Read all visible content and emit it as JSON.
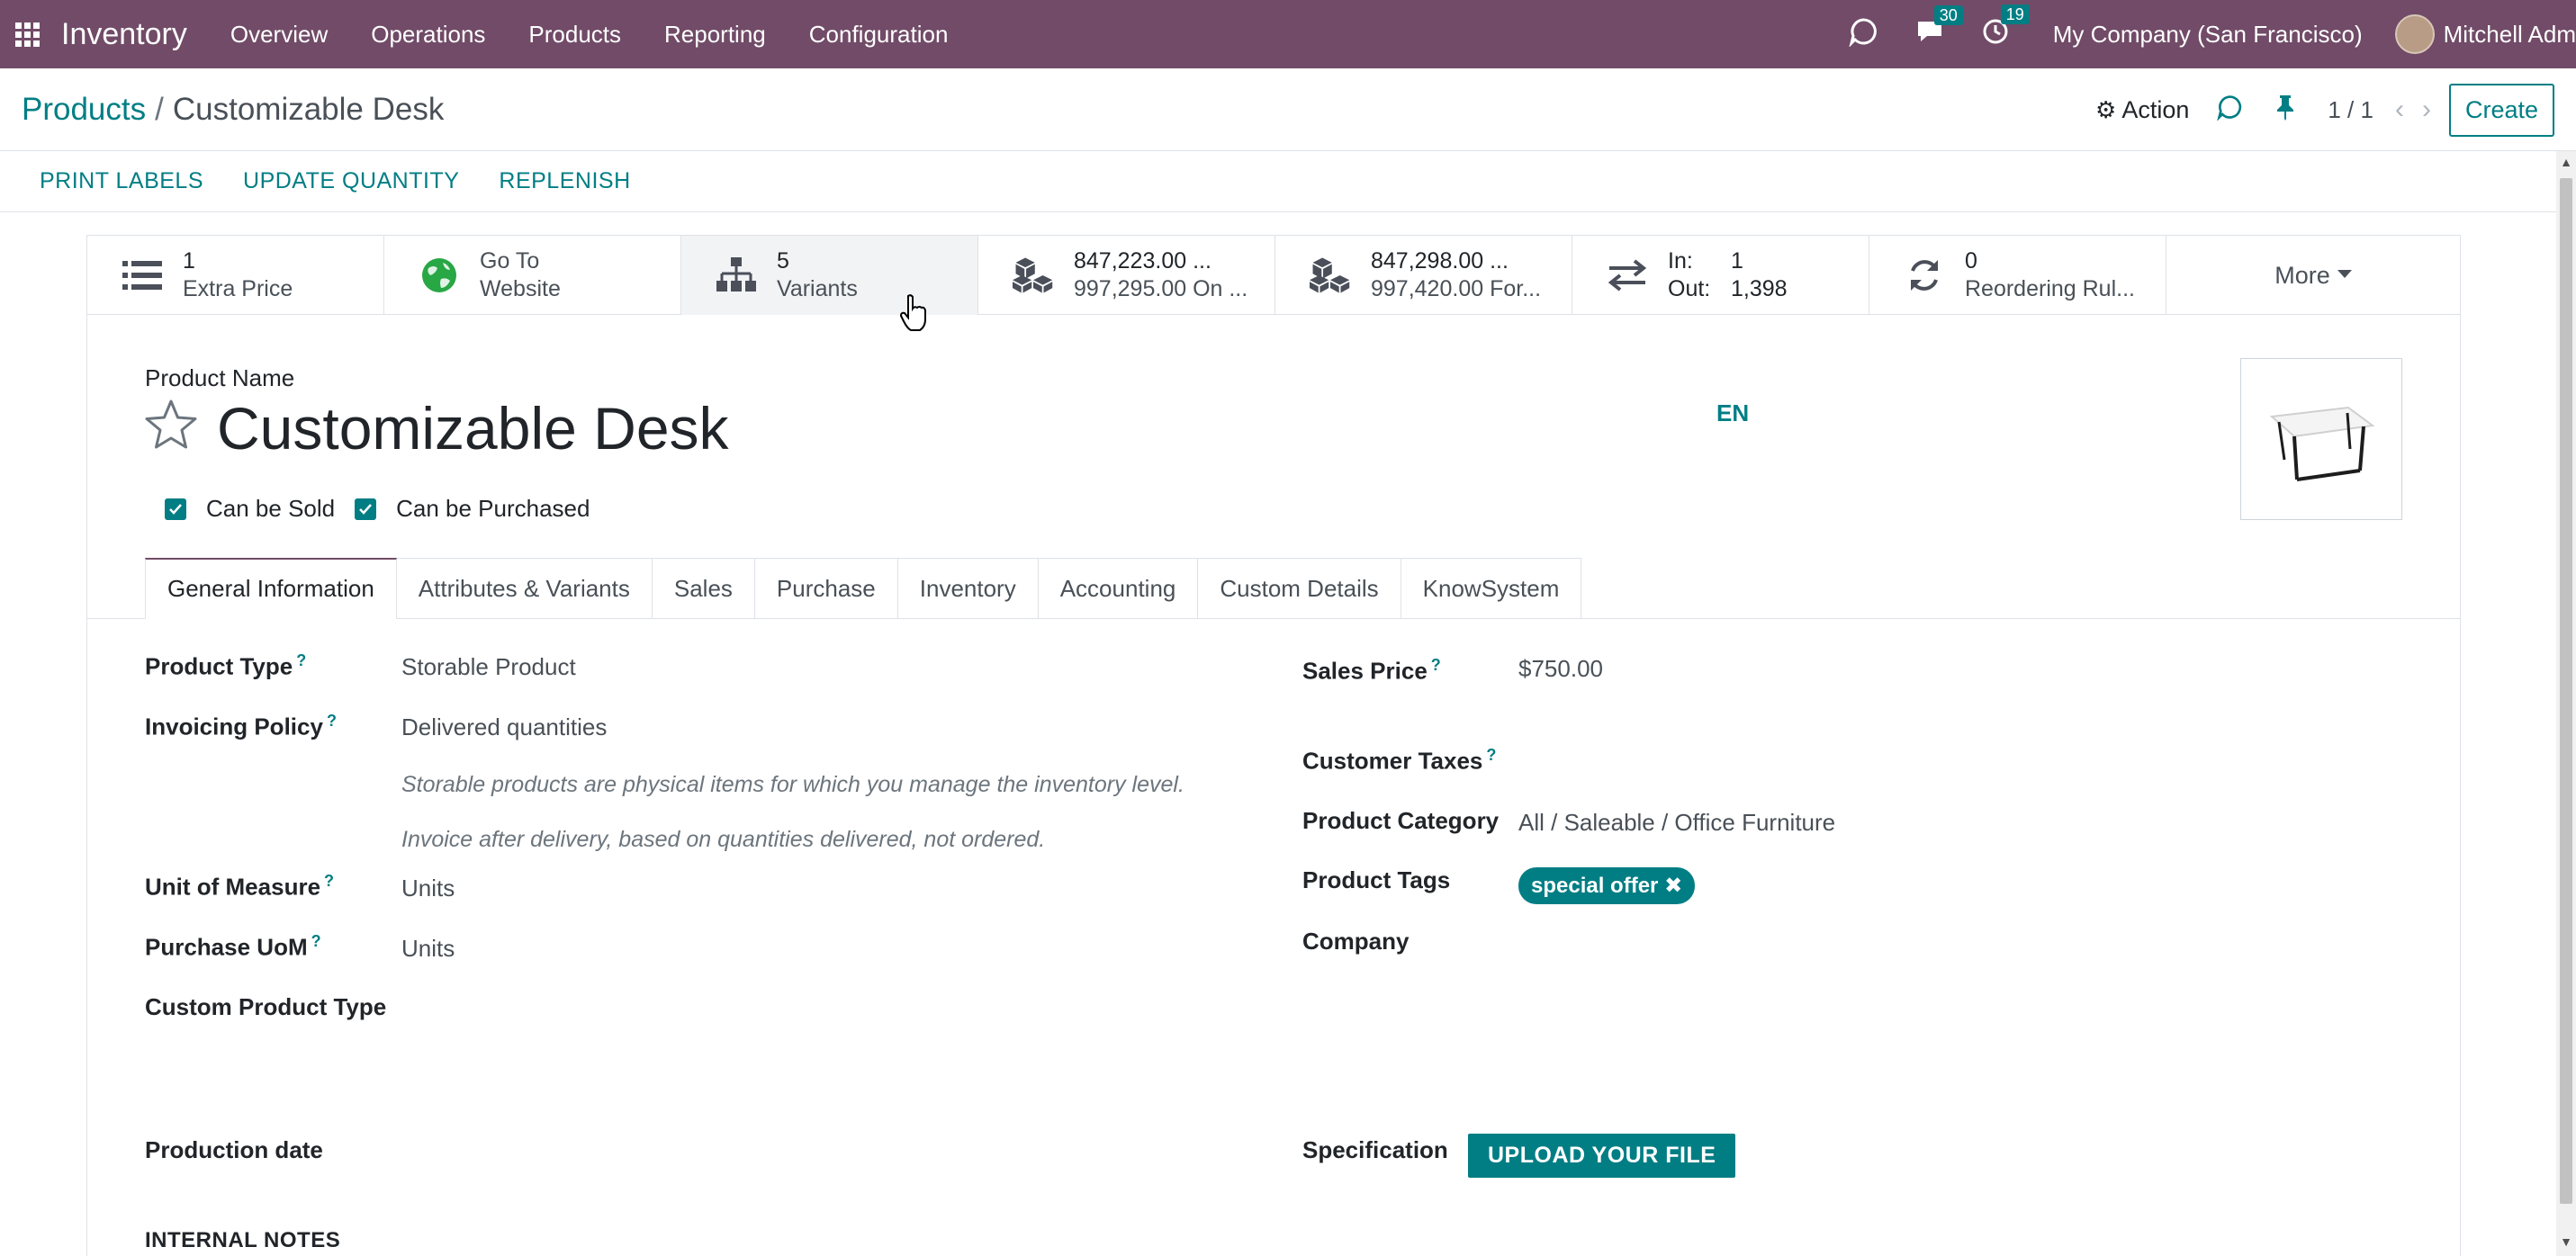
{
  "navbar": {
    "app_name": "Inventory",
    "menu": [
      "Overview",
      "Operations",
      "Products",
      "Reporting",
      "Configuration"
    ],
    "messages_count": "30",
    "activities_count": "19",
    "company": "My Company (San Francisco)",
    "user": "Mitchell Adm"
  },
  "breadcrumb": {
    "parent": "Products",
    "separator": "/",
    "current": "Customizable Desk"
  },
  "control": {
    "action_label": "Action",
    "pager": "1 / 1",
    "create_label": "Create"
  },
  "statusbar": {
    "buttons": [
      "PRINT LABELS",
      "UPDATE QUANTITY",
      "REPLENISH"
    ]
  },
  "smart_buttons": {
    "extra_price": {
      "value": "1",
      "label": "Extra Price",
      "icon": "list-icon"
    },
    "website": {
      "line1": "Go To",
      "line2": "Website",
      "icon": "globe-icon"
    },
    "variants": {
      "value": "5",
      "label": "Variants",
      "icon": "sitemap-icon"
    },
    "on_hand": {
      "line1": "847,223.00 ...",
      "line2": "997,295.00 On ...",
      "icon": "cubes-icon"
    },
    "forecast": {
      "line1": "847,298.00 ...",
      "line2": "997,420.00 For...",
      "icon": "cubes-icon"
    },
    "in_out": {
      "in_label": "In:",
      "in_value": "1",
      "out_label": "Out:",
      "out_value": "1,398",
      "icon": "exchange-icon"
    },
    "reordering": {
      "value": "0",
      "label": "Reordering Rul...",
      "icon": "refresh-icon"
    },
    "more_label": "More"
  },
  "product": {
    "name_label": "Product Name",
    "name": "Customizable Desk",
    "lang": "EN",
    "can_be_sold": "Can be Sold",
    "can_be_purchased": "Can be Purchased"
  },
  "tabs": [
    "General Information",
    "Attributes & Variants",
    "Sales",
    "Purchase",
    "Inventory",
    "Accounting",
    "Custom Details",
    "KnowSystem"
  ],
  "fields": {
    "product_type_label": "Product Type",
    "product_type": "Storable Product",
    "invoicing_policy_label": "Invoicing Policy",
    "invoicing_policy": "Delivered quantities",
    "help_storable": "Storable products are physical items for which you manage the inventory level.",
    "help_invoice": "Invoice after delivery, based on quantities delivered, not ordered.",
    "uom_label": "Unit of Measure",
    "uom": "Units",
    "purchase_uom_label": "Purchase UoM",
    "purchase_uom": "Units",
    "custom_type_label": "Custom Product Type",
    "production_date_label": "Production date",
    "sales_price_label": "Sales Price",
    "sales_price": "$750.00",
    "customer_taxes_label": "Customer Taxes",
    "category_label": "Product Category",
    "category": "All / Saleable / Office Furniture",
    "tags_label": "Product Tags",
    "tag": "special offer",
    "company_label": "Company",
    "specification_label": "Specification",
    "upload_label": "UPLOAD YOUR FILE",
    "internal_notes": "INTERNAL NOTES",
    "help_mark": "?"
  },
  "colors": {
    "brand": "#714b67",
    "accent": "#017e84"
  }
}
